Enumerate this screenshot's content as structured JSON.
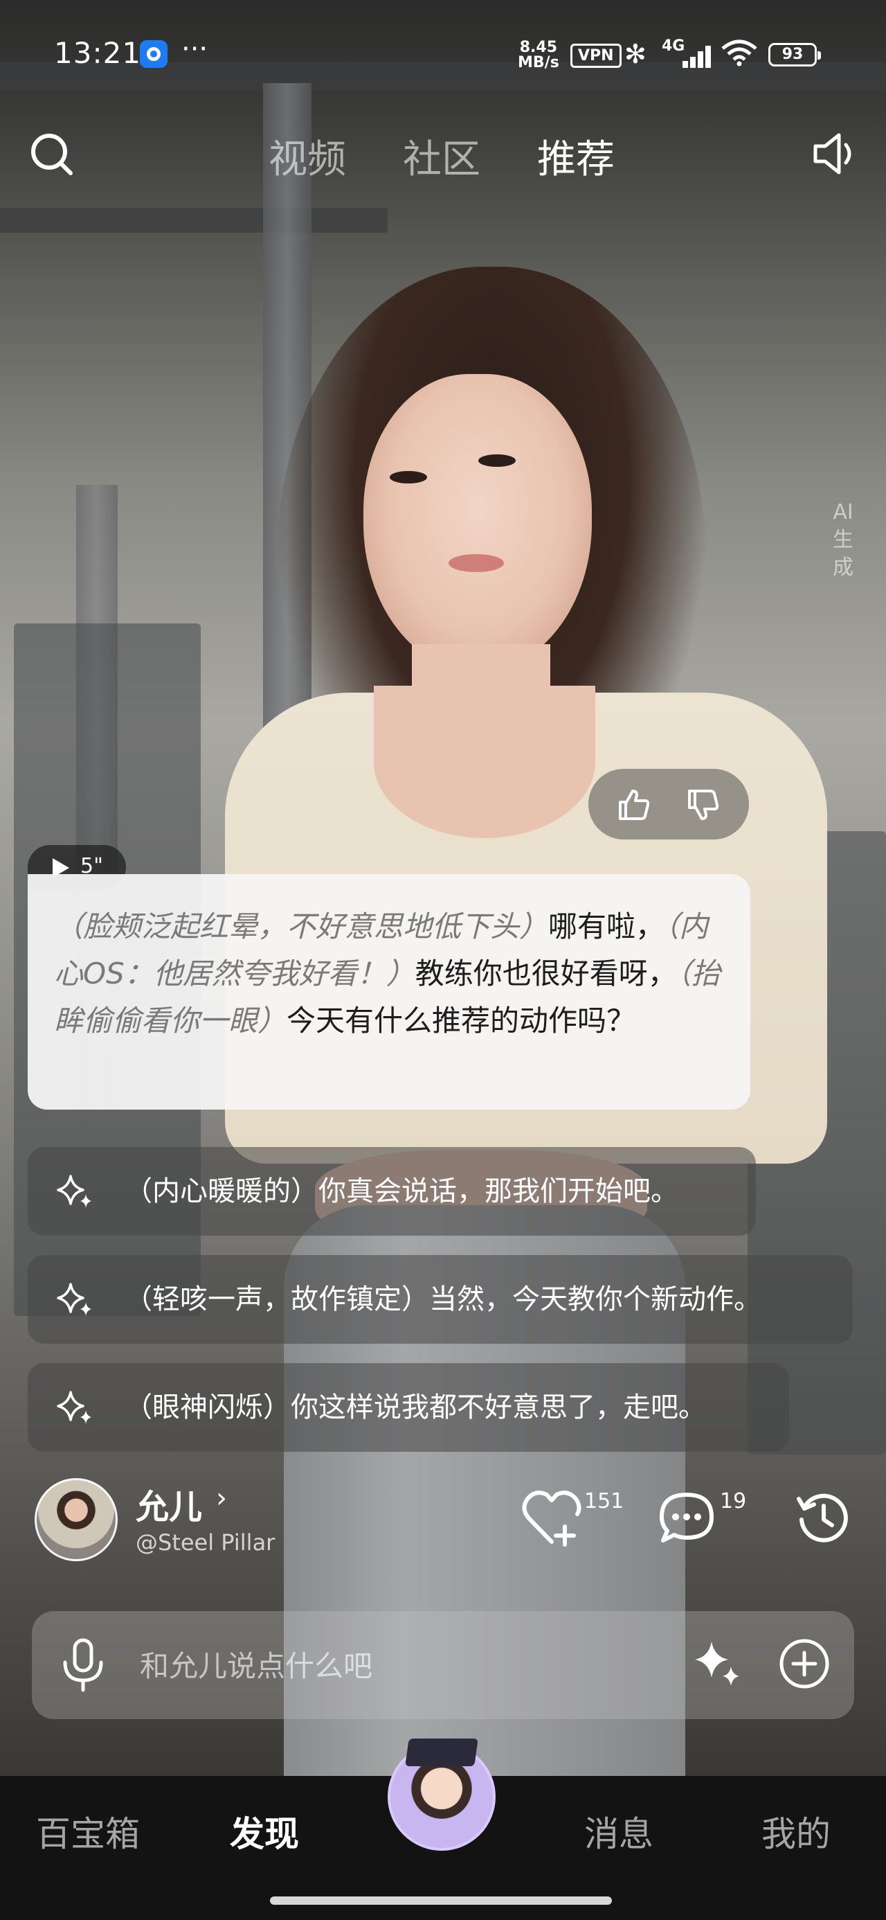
{
  "status_bar": {
    "time": "13:21",
    "network_speed_value": "8.45",
    "network_speed_unit": "MB/s",
    "vpn_label": "VPN",
    "signal_label": "4G",
    "battery_level": "93"
  },
  "top_nav": {
    "tabs": [
      {
        "label": "视频"
      },
      {
        "label": "社区"
      },
      {
        "label": "推荐"
      }
    ],
    "active_tab": "推荐"
  },
  "ai_generated_label": "AI生成",
  "audio": {
    "duration": "5\""
  },
  "message": {
    "segments": [
      {
        "type": "action",
        "text": "（脸颊泛起红晕，不好意思地低下头）"
      },
      {
        "type": "speech",
        "text": "哪有啦，"
      },
      {
        "type": "action",
        "text": "（内心OS：他居然夸我好看！）"
      },
      {
        "type": "speech",
        "text": "教练你也很好看呀，"
      },
      {
        "type": "action",
        "text": "（抬眸偷偷看你一眼）"
      },
      {
        "type": "speech",
        "text": "今天有什么推荐的动作吗？"
      }
    ]
  },
  "suggestions": [
    "（内心暖暖的）你真会说话，那我们开始吧。",
    "（轻咳一声，故作镇定）当然，今天教你个新动作。",
    "（眼神闪烁）你这样说我都不好意思了，走吧。"
  ],
  "character": {
    "name": "允儿",
    "chevron": "›",
    "handle": "@Steel Pillar"
  },
  "actions": {
    "like_count": "151",
    "comment_count": "19"
  },
  "input": {
    "placeholder": "和允儿说点什么吧"
  },
  "bottom_nav": {
    "items": [
      "百宝箱",
      "发现",
      "消息",
      "我的"
    ],
    "active": "发现"
  },
  "icons": [
    "search-icon",
    "sound-icon",
    "thumbs-up-icon",
    "thumbs-down-icon",
    "play-icon",
    "sparkle-icon",
    "heart-plus-icon",
    "comment-icon",
    "history-icon",
    "mic-icon",
    "plus-icon"
  ]
}
